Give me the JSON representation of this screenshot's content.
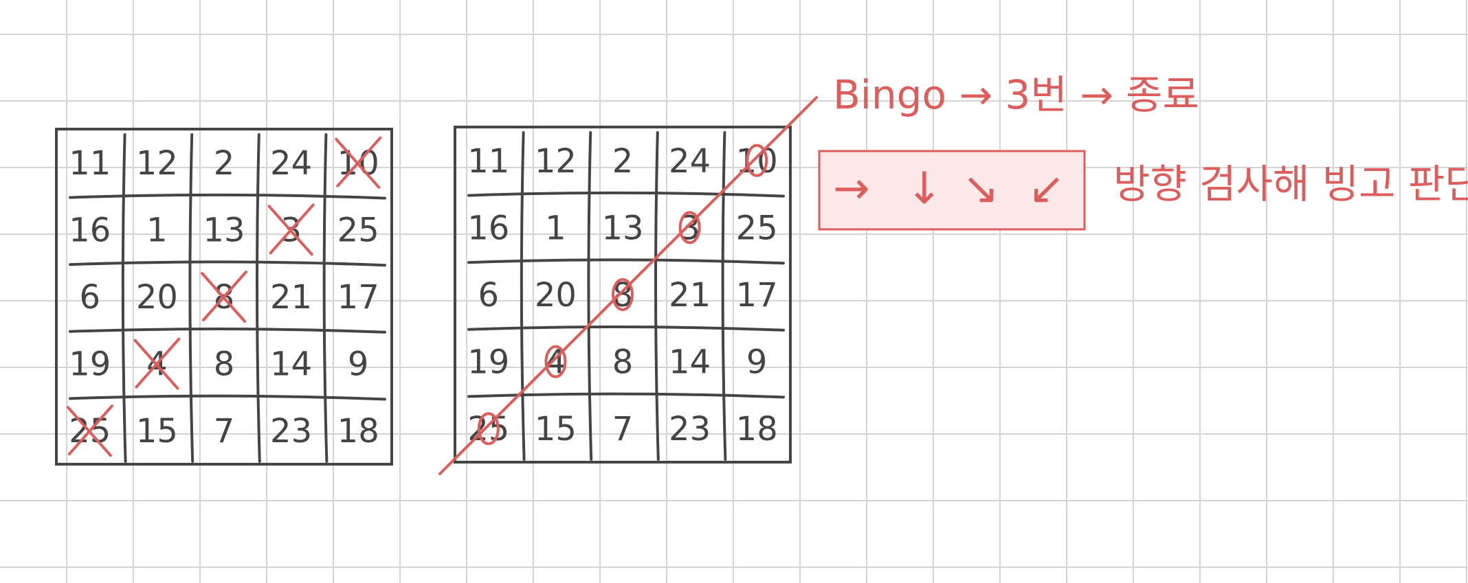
{
  "colors": {
    "ink": "#444444",
    "accent": "#dd5c5c",
    "grid": "#d4d4d4",
    "box_fill": "#fbe8e8"
  },
  "board_numbers": [
    [
      "11",
      "12",
      "2",
      "24",
      "10"
    ],
    [
      "16",
      "1",
      "13",
      "3",
      "25"
    ],
    [
      "6",
      "20",
      "8",
      "21",
      "17"
    ],
    [
      "19",
      "4",
      "8",
      "14",
      "9"
    ],
    [
      "25",
      "15",
      "7",
      "23",
      "18"
    ]
  ],
  "left_board": {
    "crossed": [
      [
        0,
        4
      ],
      [
        1,
        3
      ],
      [
        2,
        2
      ],
      [
        3,
        1
      ],
      [
        4,
        0
      ]
    ]
  },
  "right_board": {
    "circled": [
      [
        0,
        4
      ],
      [
        1,
        3
      ],
      [
        2,
        2
      ],
      [
        3,
        1
      ],
      [
        4,
        0
      ]
    ]
  },
  "annotation": {
    "bingo_flow": "Bingo → 3번 → 종료",
    "check_text": "방향 검사해 빙고 판단",
    "direction_icons": [
      "right-arrow-icon",
      "down-arrow-icon",
      "diagonal-down-right-arrow-icon",
      "diagonal-down-left-arrow-icon"
    ],
    "direction_glyphs": [
      "→",
      "↓",
      "↘",
      "↙"
    ]
  }
}
